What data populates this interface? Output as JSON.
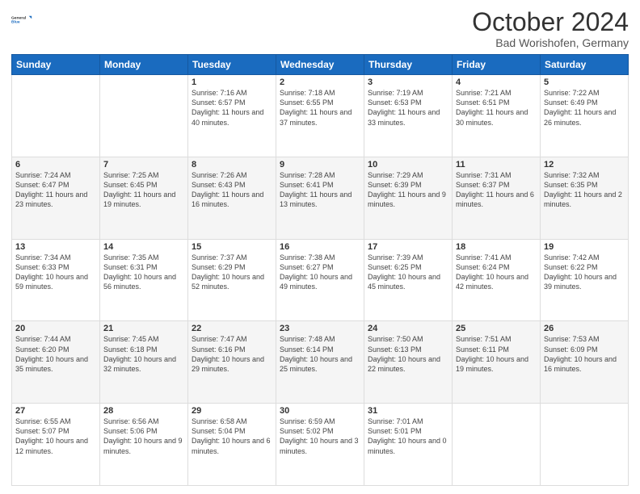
{
  "header": {
    "logo_line1": "General",
    "logo_line2": "Blue",
    "month": "October 2024",
    "location": "Bad Worishofen, Germany"
  },
  "weekdays": [
    "Sunday",
    "Monday",
    "Tuesday",
    "Wednesday",
    "Thursday",
    "Friday",
    "Saturday"
  ],
  "rows": [
    [
      {
        "day": "",
        "info": ""
      },
      {
        "day": "",
        "info": ""
      },
      {
        "day": "1",
        "info": "Sunrise: 7:16 AM\nSunset: 6:57 PM\nDaylight: 11 hours and 40 minutes."
      },
      {
        "day": "2",
        "info": "Sunrise: 7:18 AM\nSunset: 6:55 PM\nDaylight: 11 hours and 37 minutes."
      },
      {
        "day": "3",
        "info": "Sunrise: 7:19 AM\nSunset: 6:53 PM\nDaylight: 11 hours and 33 minutes."
      },
      {
        "day": "4",
        "info": "Sunrise: 7:21 AM\nSunset: 6:51 PM\nDaylight: 11 hours and 30 minutes."
      },
      {
        "day": "5",
        "info": "Sunrise: 7:22 AM\nSunset: 6:49 PM\nDaylight: 11 hours and 26 minutes."
      }
    ],
    [
      {
        "day": "6",
        "info": "Sunrise: 7:24 AM\nSunset: 6:47 PM\nDaylight: 11 hours and 23 minutes."
      },
      {
        "day": "7",
        "info": "Sunrise: 7:25 AM\nSunset: 6:45 PM\nDaylight: 11 hours and 19 minutes."
      },
      {
        "day": "8",
        "info": "Sunrise: 7:26 AM\nSunset: 6:43 PM\nDaylight: 11 hours and 16 minutes."
      },
      {
        "day": "9",
        "info": "Sunrise: 7:28 AM\nSunset: 6:41 PM\nDaylight: 11 hours and 13 minutes."
      },
      {
        "day": "10",
        "info": "Sunrise: 7:29 AM\nSunset: 6:39 PM\nDaylight: 11 hours and 9 minutes."
      },
      {
        "day": "11",
        "info": "Sunrise: 7:31 AM\nSunset: 6:37 PM\nDaylight: 11 hours and 6 minutes."
      },
      {
        "day": "12",
        "info": "Sunrise: 7:32 AM\nSunset: 6:35 PM\nDaylight: 11 hours and 2 minutes."
      }
    ],
    [
      {
        "day": "13",
        "info": "Sunrise: 7:34 AM\nSunset: 6:33 PM\nDaylight: 10 hours and 59 minutes."
      },
      {
        "day": "14",
        "info": "Sunrise: 7:35 AM\nSunset: 6:31 PM\nDaylight: 10 hours and 56 minutes."
      },
      {
        "day": "15",
        "info": "Sunrise: 7:37 AM\nSunset: 6:29 PM\nDaylight: 10 hours and 52 minutes."
      },
      {
        "day": "16",
        "info": "Sunrise: 7:38 AM\nSunset: 6:27 PM\nDaylight: 10 hours and 49 minutes."
      },
      {
        "day": "17",
        "info": "Sunrise: 7:39 AM\nSunset: 6:25 PM\nDaylight: 10 hours and 45 minutes."
      },
      {
        "day": "18",
        "info": "Sunrise: 7:41 AM\nSunset: 6:24 PM\nDaylight: 10 hours and 42 minutes."
      },
      {
        "day": "19",
        "info": "Sunrise: 7:42 AM\nSunset: 6:22 PM\nDaylight: 10 hours and 39 minutes."
      }
    ],
    [
      {
        "day": "20",
        "info": "Sunrise: 7:44 AM\nSunset: 6:20 PM\nDaylight: 10 hours and 35 minutes."
      },
      {
        "day": "21",
        "info": "Sunrise: 7:45 AM\nSunset: 6:18 PM\nDaylight: 10 hours and 32 minutes."
      },
      {
        "day": "22",
        "info": "Sunrise: 7:47 AM\nSunset: 6:16 PM\nDaylight: 10 hours and 29 minutes."
      },
      {
        "day": "23",
        "info": "Sunrise: 7:48 AM\nSunset: 6:14 PM\nDaylight: 10 hours and 25 minutes."
      },
      {
        "day": "24",
        "info": "Sunrise: 7:50 AM\nSunset: 6:13 PM\nDaylight: 10 hours and 22 minutes."
      },
      {
        "day": "25",
        "info": "Sunrise: 7:51 AM\nSunset: 6:11 PM\nDaylight: 10 hours and 19 minutes."
      },
      {
        "day": "26",
        "info": "Sunrise: 7:53 AM\nSunset: 6:09 PM\nDaylight: 10 hours and 16 minutes."
      }
    ],
    [
      {
        "day": "27",
        "info": "Sunrise: 6:55 AM\nSunset: 5:07 PM\nDaylight: 10 hours and 12 minutes."
      },
      {
        "day": "28",
        "info": "Sunrise: 6:56 AM\nSunset: 5:06 PM\nDaylight: 10 hours and 9 minutes."
      },
      {
        "day": "29",
        "info": "Sunrise: 6:58 AM\nSunset: 5:04 PM\nDaylight: 10 hours and 6 minutes."
      },
      {
        "day": "30",
        "info": "Sunrise: 6:59 AM\nSunset: 5:02 PM\nDaylight: 10 hours and 3 minutes."
      },
      {
        "day": "31",
        "info": "Sunrise: 7:01 AM\nSunset: 5:01 PM\nDaylight: 10 hours and 0 minutes."
      },
      {
        "day": "",
        "info": ""
      },
      {
        "day": "",
        "info": ""
      }
    ]
  ]
}
